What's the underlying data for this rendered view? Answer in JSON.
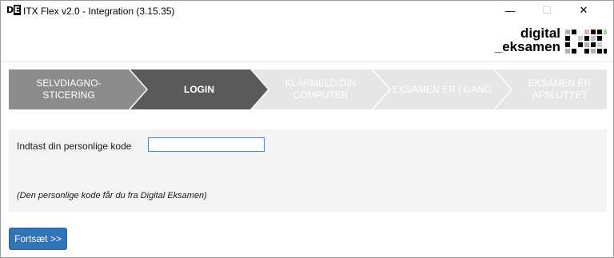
{
  "window": {
    "icon_text_1": "D",
    "icon_text_2": "E",
    "title": "ITX Flex v2.0 - Integration (3.15.35)",
    "minimize_glyph": "—",
    "maximize_glyph": "☐",
    "close_glyph": "✕"
  },
  "logo": {
    "line1": "digital",
    "line2": "_eksamen",
    "mark_text": "DE"
  },
  "steps": [
    {
      "label_line1": "SELVDIAGNO-",
      "label_line2": "STICERING",
      "state": "done"
    },
    {
      "label_line1": "LOGIN",
      "label_line2": "",
      "state": "active"
    },
    {
      "label_line1": "KLARMELD DIN",
      "label_line2": "COMPUTER",
      "state": "pending"
    },
    {
      "label_line1": "EKSAMEN ER I GANG",
      "label_line2": "",
      "state": "pending"
    },
    {
      "label_line1": "EKSAMEN ER",
      "label_line2": "AFSLUTTET",
      "state": "pending"
    }
  ],
  "colors": {
    "step_done": "#8c8c8c",
    "step_active": "#5a5a5a",
    "step_pending": "#e6e6e6",
    "step_text_light": "#ffffff",
    "step_text_pending": "#ffffff",
    "accent": "#3174b5"
  },
  "form": {
    "code_label": "Indtast din personlige kode",
    "code_value": "",
    "hint": "(Den personlige kode får du fra Digital Eksamen)"
  },
  "actions": {
    "continue_label": "Fortsæt >>"
  }
}
